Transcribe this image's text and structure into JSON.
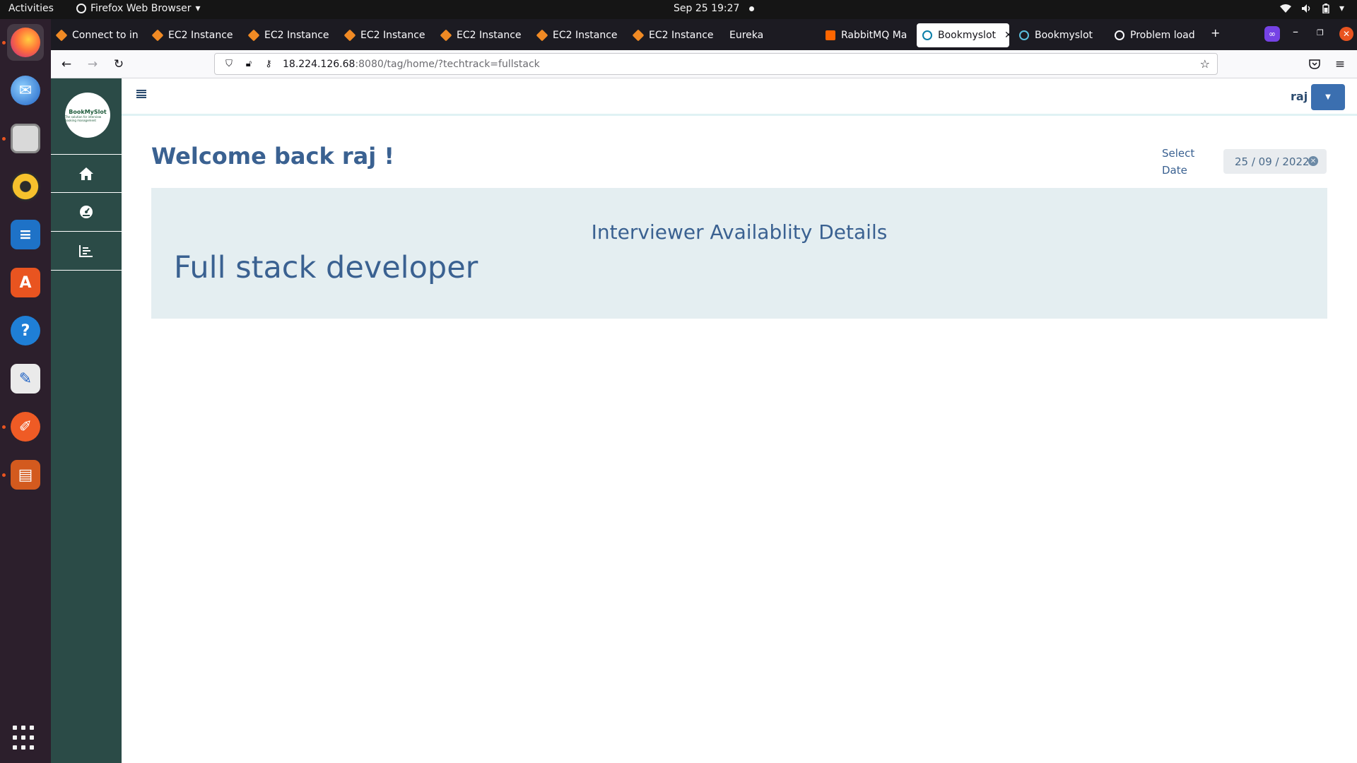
{
  "system_bar": {
    "activities": "Activities",
    "app_menu": "Firefox Web Browser",
    "clock": "Sep 25  19:27"
  },
  "dock": {
    "items": [
      {
        "name": "firefox-icon",
        "color": "#e66000"
      },
      {
        "name": "thunderbird-icon",
        "color": "#1f62c4"
      },
      {
        "name": "files-icon",
        "color": "#8a8a8a"
      },
      {
        "name": "rhythmbox-icon",
        "color": "#f6c22d"
      },
      {
        "name": "libreoffice-writer-icon",
        "color": "#1e72c7"
      },
      {
        "name": "app-center-icon",
        "color": "#e95420"
      },
      {
        "name": "help-icon",
        "color": "#1f7fd6"
      },
      {
        "name": "text-editor-icon",
        "color": "#eaeaea"
      },
      {
        "name": "postman-icon",
        "color": "#ef5b25"
      },
      {
        "name": "libreoffice-impress-icon",
        "color": "#d35a1e"
      }
    ]
  },
  "browser": {
    "tabs": [
      {
        "label": "Connect to in",
        "icon": "aws-icon"
      },
      {
        "label": "EC2 Instance",
        "icon": "aws-icon"
      },
      {
        "label": "EC2 Instance",
        "icon": "aws-icon"
      },
      {
        "label": "EC2 Instance",
        "icon": "aws-icon"
      },
      {
        "label": "EC2 Instance",
        "icon": "aws-icon"
      },
      {
        "label": "EC2 Instance",
        "icon": "aws-icon"
      },
      {
        "label": "EC2 Instance",
        "icon": "aws-icon"
      },
      {
        "label": "Eureka",
        "icon": ""
      },
      {
        "label": "RabbitMQ Ma",
        "icon": "rabbitmq-icon"
      },
      {
        "label": "Bookmyslot",
        "icon": "react-icon",
        "active": true
      },
      {
        "label": "Bookmyslot",
        "icon": "react-icon"
      },
      {
        "label": "Problem load",
        "icon": "info-icon"
      }
    ],
    "url_host": "18.224.126.68",
    "url_rest": ":8080/tag/home/?techtrack=fullstack"
  },
  "app": {
    "logo_text": "BookMySlot",
    "logo_tagline": "The solution for interview booking management",
    "user": "raj",
    "welcome": "Welcome back raj !",
    "date_label": "Select Date",
    "date_value": "25 / 09 / 2022",
    "panel_heading": "Interviewer Availablity Details",
    "tech_track": "Full stack developer"
  },
  "colors": {
    "sidebar": "#2b4b47",
    "accent_text": "#3a6191",
    "panel_bg": "#e4eef1",
    "user_button": "#3b6fb0"
  }
}
